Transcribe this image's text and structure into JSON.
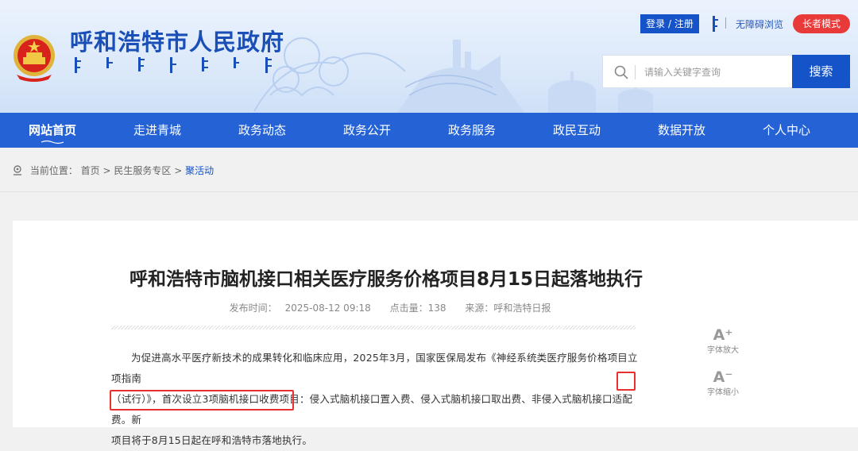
{
  "header": {
    "site_title": "呼和浩特市人民政府",
    "login_label": "登录 / 注册",
    "accessibility_label": "无障碍浏览",
    "elder_mode_label": "长者模式",
    "search": {
      "placeholder": "请输入关键字查询",
      "button_label": "搜索"
    }
  },
  "nav": {
    "items": [
      {
        "label": "网站首页"
      },
      {
        "label": "走进青城"
      },
      {
        "label": "政务动态"
      },
      {
        "label": "政务公开"
      },
      {
        "label": "政务服务"
      },
      {
        "label": "政民互动"
      },
      {
        "label": "数据开放"
      },
      {
        "label": "个人中心"
      }
    ]
  },
  "breadcrumb": {
    "prefix": "当前位置：",
    "items": [
      "首页",
      "民生服务专区",
      "聚活动"
    ],
    "separator": ">"
  },
  "article": {
    "title": "呼和浩特市脑机接口相关医疗服务价格项目8月15日起落地执行",
    "publish_time_label": "发布时间：",
    "publish_time": "2025-08-12 09:18",
    "views_label": "点击量：",
    "views": "138",
    "source_label": "来源：",
    "source": "呼和浩特日报",
    "paragraph_line1": "为促进高水平医疗新技术的成果转化和临床应用，2025年3月，国家医保局发布《神经系统类医疗服务价格项目立项指南",
    "paragraph_line2": "（试行）》，首次设立3项脑机接口收费项目：侵入式脑机接口置入费、侵入式脑机接口取出费、非侵入式脑机接口适配费。",
    "highlight_char": "新",
    "paragraph_line3": "项目将于8月15日起在呼和浩特市落地执行。"
  },
  "font_tools": {
    "enlarge_glyph": "A⁺",
    "enlarge_label": "字体放大",
    "shrink_glyph": "A⁻",
    "shrink_label": "字体缩小"
  },
  "colors": {
    "primary": "#1453c8",
    "nav_bg": "#2462d6",
    "elder_btn": "#e93a3a",
    "highlight_border": "#e83030"
  }
}
